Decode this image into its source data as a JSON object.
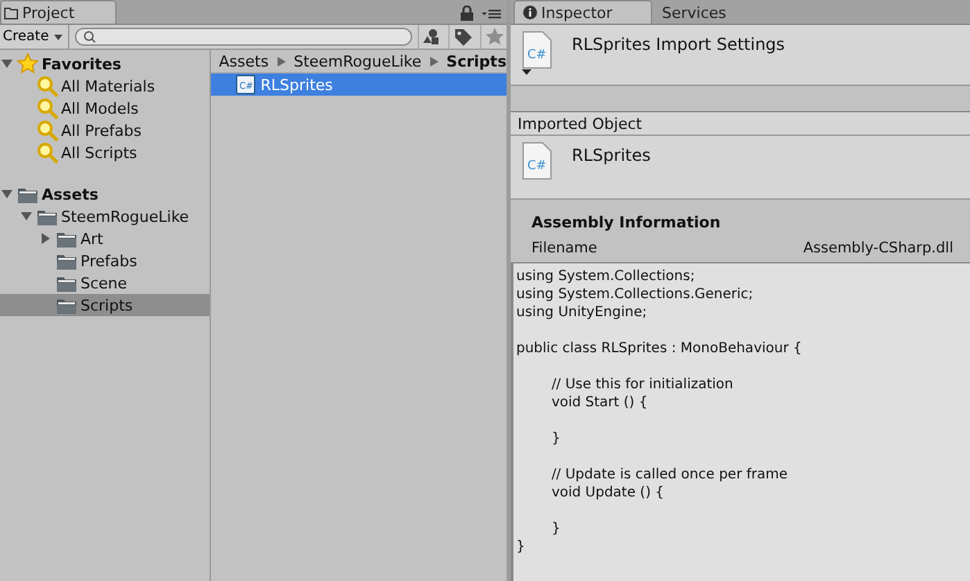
{
  "project_panel": {
    "tab": {
      "label": "Project",
      "selected": true
    },
    "toolbar": {
      "create_label": "Create"
    },
    "tree": [
      {
        "label": "Favorites",
        "kind": "group",
        "expanded": true,
        "selected": false,
        "children": [
          {
            "label": "All Materials",
            "kind": "search",
            "selected": false
          },
          {
            "label": "All Models",
            "kind": "search",
            "selected": false
          },
          {
            "label": "All Prefabs",
            "kind": "search",
            "selected": false
          },
          {
            "label": "All Scripts",
            "kind": "search",
            "selected": false
          }
        ]
      },
      {
        "label": "Assets",
        "kind": "root",
        "expanded": true,
        "selected": false,
        "children": [
          {
            "label": "SteemRogueLike",
            "kind": "folder",
            "expanded": true,
            "selected": false,
            "children": [
              {
                "label": "Art",
                "kind": "folder",
                "expanded": false,
                "selected": false
              },
              {
                "label": "Prefabs",
                "kind": "folder",
                "selected": false
              },
              {
                "label": "Scene",
                "kind": "folder",
                "selected": false
              },
              {
                "label": "Scripts",
                "kind": "folder",
                "selected": true
              }
            ]
          }
        ]
      }
    ],
    "breadcrumb": [
      "Assets",
      "SteemRogueLike",
      "Scripts"
    ],
    "files": [
      {
        "name": "RLSprites",
        "icon_text": "C#",
        "selected": true
      }
    ]
  },
  "inspector_panel": {
    "tabs": [
      {
        "label": "Inspector",
        "selected": true
      },
      {
        "label": "Services",
        "selected": false
      }
    ],
    "title": "RLSprites Import Settings",
    "title_icon_text": "C#",
    "section_label": "Imported Object",
    "object_name": "RLSprites",
    "object_icon_text": "C#",
    "assembly": {
      "heading": "Assembly Information",
      "field_label": "Filename",
      "field_value": "Assembly-CSharp.dll"
    },
    "code_lines": [
      {
        "kind": "text",
        "text": "using System.Collections;"
      },
      {
        "kind": "text",
        "text": "using System.Collections.Generic;"
      },
      {
        "kind": "text",
        "text": "using UnityEngine;"
      },
      {
        "kind": "blank"
      },
      {
        "kind": "text",
        "text": "public class RLSprites : MonoBehaviour {"
      },
      {
        "kind": "blank"
      },
      {
        "kind": "text",
        "text": "\t// Use this for initialization"
      },
      {
        "kind": "text",
        "text": "\tvoid Start () {"
      },
      {
        "kind": "blank"
      },
      {
        "kind": "text",
        "text": "\t}"
      },
      {
        "kind": "blank"
      },
      {
        "kind": "text",
        "text": "\t// Update is called once per frame"
      },
      {
        "kind": "text",
        "text": "\tvoid Update () {"
      },
      {
        "kind": "blank"
      },
      {
        "kind": "text",
        "text": "\t}"
      },
      {
        "kind": "text",
        "text": "}"
      }
    ]
  }
}
